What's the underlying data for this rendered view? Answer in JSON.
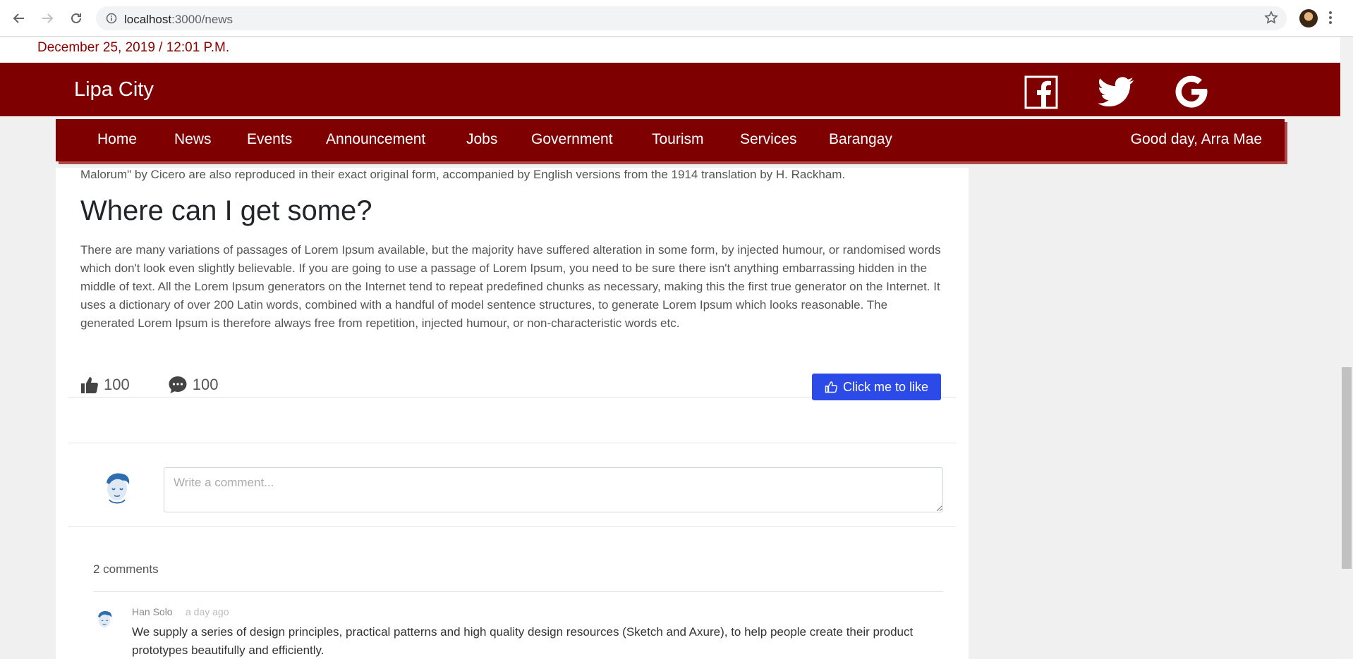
{
  "browser": {
    "url_host": "localhost",
    "url_path": ":3000/news"
  },
  "top_strip": {
    "datetime": "December 25, 2019 / 12:01 P.M."
  },
  "header": {
    "brand": "Lipa City",
    "social_icons": [
      "facebook-icon",
      "twitter-icon",
      "google-icon"
    ]
  },
  "nav": {
    "items": [
      {
        "label": "Home"
      },
      {
        "label": "News"
      },
      {
        "label": "Events"
      },
      {
        "label": "Announcement"
      },
      {
        "label": "Jobs"
      },
      {
        "label": "Government"
      },
      {
        "label": "Tourism"
      },
      {
        "label": "Services"
      },
      {
        "label": "Barangay"
      }
    ],
    "greeting": "Good day, Arra Mae"
  },
  "article": {
    "cut_text": "Malorum\" by Cicero are also reproduced in their exact original form, accompanied by English versions from the 1914 translation by H. Rackham.",
    "heading": "Where can I get some?",
    "paragraph": "There are many variations of passages of Lorem Ipsum available, but the majority have suffered alteration in some form, by injected humour, or randomised words which don't look even slightly believable. If you are going to use a passage of Lorem Ipsum, you need to be sure there isn't anything embarrassing hidden in the middle of text. All the Lorem Ipsum generators on the Internet tend to repeat predefined chunks as necessary, making this the first true generator on the Internet. It uses a dictionary of over 200 Latin words, combined with a handful of model sentence structures, to generate Lorem Ipsum which looks reasonable. The generated Lorem Ipsum is therefore always free from repetition, injected humour, or non-characteristic words etc."
  },
  "stats": {
    "likes": "100",
    "comments": "100"
  },
  "like_button": {
    "label": "Click me to like"
  },
  "comment_input": {
    "placeholder": "Write a comment..."
  },
  "comments": {
    "count_label": "2 comments",
    "items": [
      {
        "author": "Han Solo",
        "time": "a day ago",
        "text": "We supply a series of design principles, practical patterns and high quality design resources (Sketch and Axure), to help people create their product prototypes beautifully and efficiently."
      }
    ]
  },
  "colors": {
    "brand_red": "#7f0000",
    "primary_blue": "#2b4ae8"
  }
}
